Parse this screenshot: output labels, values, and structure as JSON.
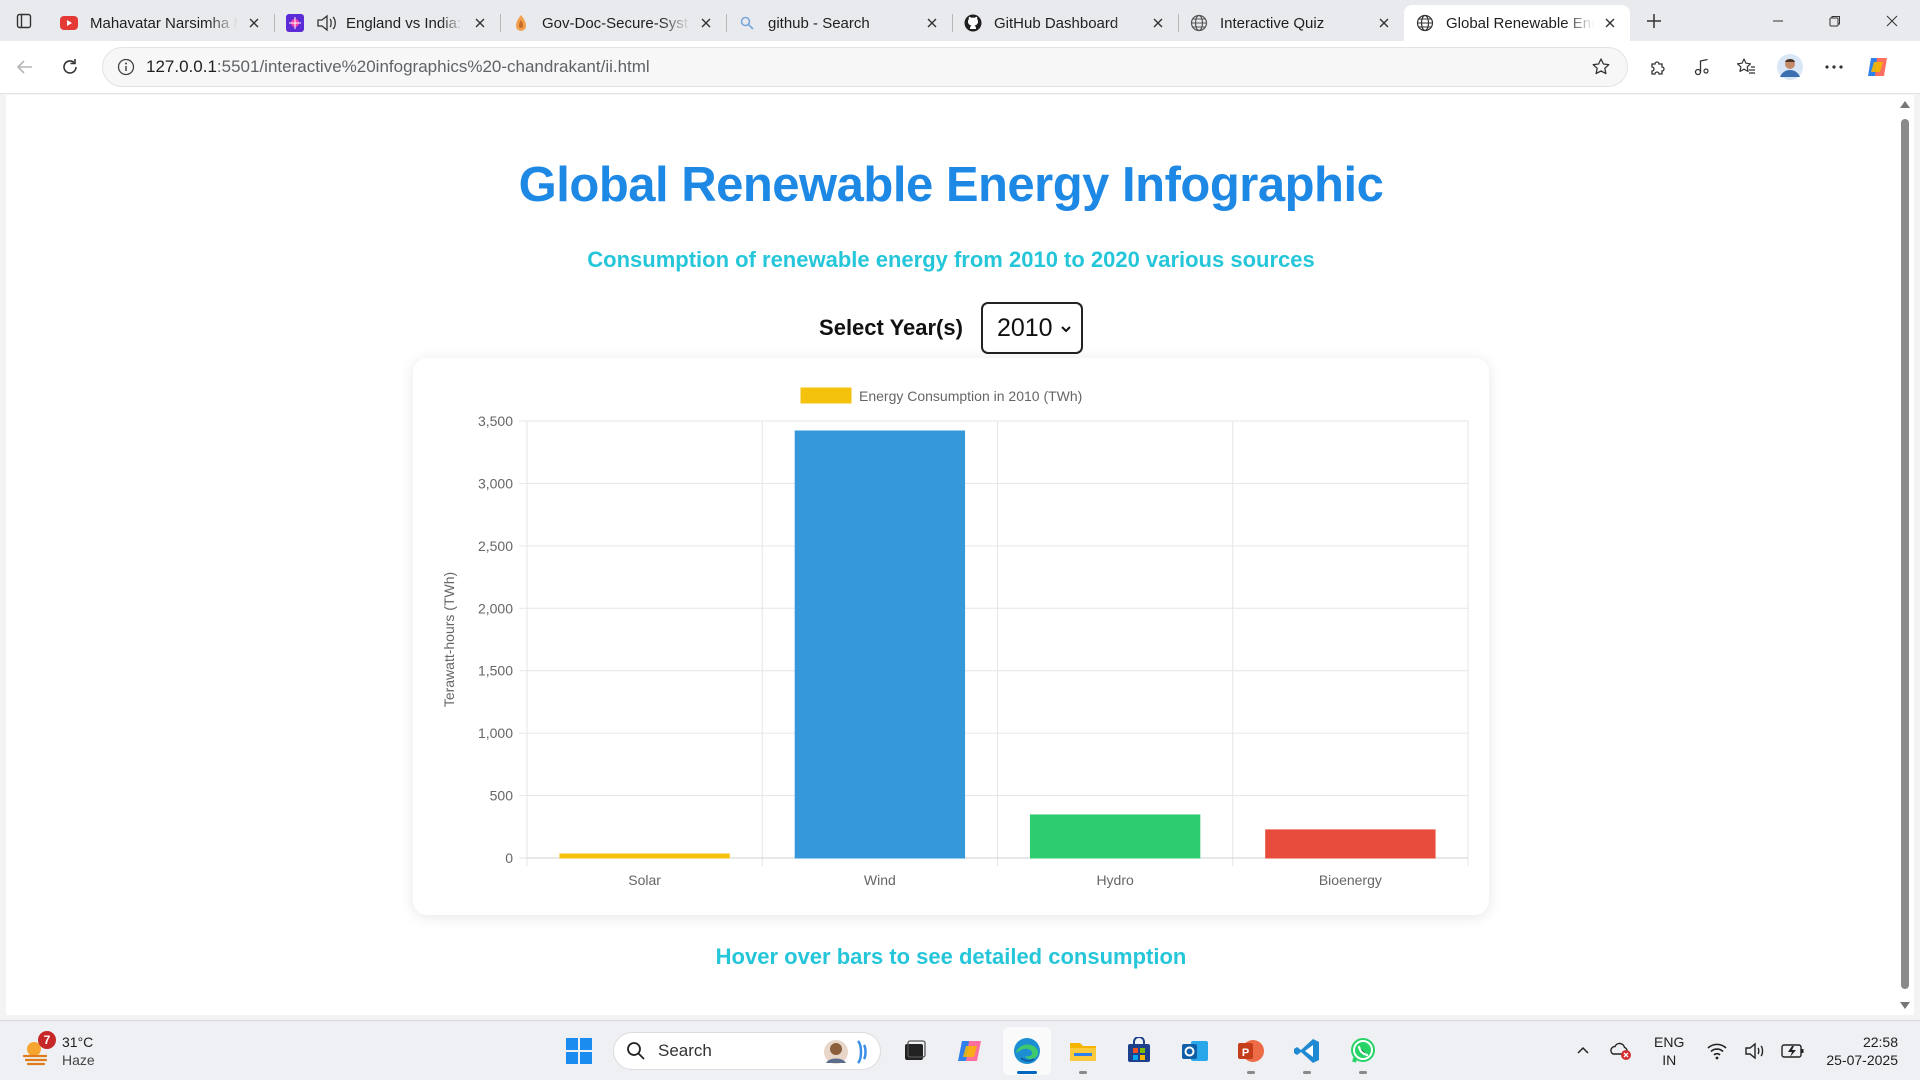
{
  "browser": {
    "tabs": [
      {
        "title": "Mahavatar Narsimha M",
        "icon": "youtube-icon",
        "audio": false
      },
      {
        "title": "England vs India: ",
        "icon": "cricket-icon",
        "audio": true
      },
      {
        "title": "Gov-Doc-Secure-Syste",
        "icon": "app-icon",
        "audio": false
      },
      {
        "title": "github - Search",
        "icon": "search-icon",
        "audio": false
      },
      {
        "title": "GitHub Dashboard",
        "icon": "github-icon",
        "audio": false
      },
      {
        "title": "Interactive Quiz",
        "icon": "globe-icon",
        "audio": false
      },
      {
        "title": "Global Renewable Ene",
        "icon": "globe-icon",
        "audio": false,
        "active": true
      }
    ],
    "url_host": "127.0.0.1",
    "url_rest": ":5501/interactive%20infographics%20-chandrakant/ii.html"
  },
  "page": {
    "title": "Global Renewable Energy Infographic",
    "subtitle": "Consumption of renewable energy from 2010 to 2020 various sources",
    "year_label": "Select Year(s)",
    "selected_year": "2010",
    "hint": "Hover over bars to see detailed consumption"
  },
  "chart_data": {
    "type": "bar",
    "categories": [
      "Solar",
      "Wind",
      "Hydro",
      "Bioenergy"
    ],
    "series": [
      {
        "name": "Energy Consumption in 2010 (TWh)",
        "values": [
          32,
          3420,
          345,
          225
        ]
      }
    ],
    "colors": [
      "#f4c20d",
      "#3498db",
      "#2ecc71",
      "#e74c3c"
    ],
    "legend_color": "#f4c20d",
    "ylabel": "Terawatt-hours (TWh)",
    "xlabel": "",
    "ylim": [
      0,
      3500
    ],
    "yticks": [
      0,
      500,
      1000,
      1500,
      2000,
      2500,
      3000,
      3500
    ],
    "ytick_labels": [
      "0",
      "500",
      "1,000",
      "1,500",
      "2,000",
      "2,500",
      "3,000",
      "3,500"
    ],
    "grid": true,
    "legend_position": "top-center"
  },
  "taskbar": {
    "weather": {
      "temp": "31°C",
      "condition": "Haze",
      "badge": "7"
    },
    "search_label": "Search",
    "lang": "ENG",
    "region": "IN",
    "time": "22:58",
    "date": "25-07-2025"
  },
  "colors": {
    "title": "#1e88e5",
    "subtitle": "#26c6da",
    "accent": "#0067c0"
  }
}
